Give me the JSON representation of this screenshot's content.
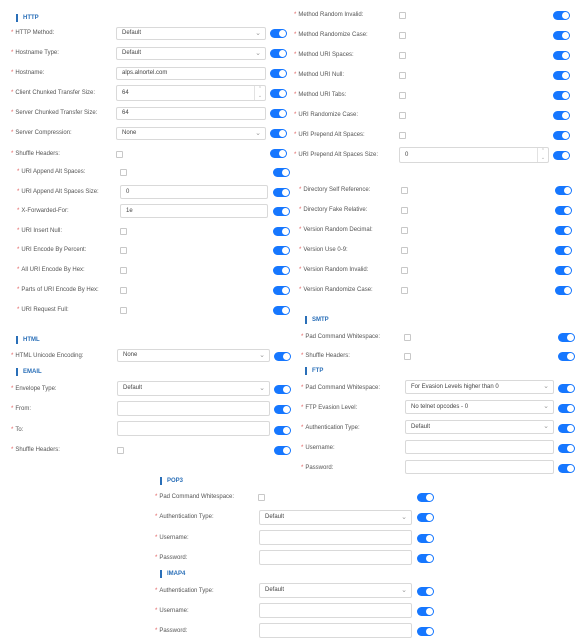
{
  "http": {
    "title": "HTTP",
    "method": {
      "label": "HTTP Method:",
      "value": "Default"
    },
    "hostname_type": {
      "label": "Hostname Type:",
      "value": "Default"
    },
    "hostname": {
      "label": "Hostname:",
      "value": "alps.alnortel.com"
    },
    "client_chunked": {
      "label": "Client Chunked Transfer Size:",
      "value": "64"
    },
    "server_chunked": {
      "label": "Server Chunked Transfer Size:",
      "value": "64"
    },
    "server_compression": {
      "label": "Server Compression:",
      "value": "None"
    },
    "shuffle_headers": {
      "label": "Shuffle Headers:"
    },
    "uri_append_alt_spaces": {
      "label": "URI Append Alt Spaces:"
    },
    "uri_append_alt_spaces_size": {
      "label": "URI Append Alt Spaces Size:",
      "value": "0"
    },
    "x_forwarded_for": {
      "label": "X-Forwarded-For:",
      "value": "1e"
    },
    "uri_insert_null": {
      "label": "URI Insert Null:"
    },
    "uri_encode_by_percent": {
      "label": "URI Encode By Percent:"
    },
    "all_uri_encode_by_hex": {
      "label": "All URI Encode By Hex:"
    },
    "parts_of_uri_encode_by_hex": {
      "label": "Parts of URI Encode By Hex:"
    },
    "uri_request_full": {
      "label": "URI Request Full:"
    },
    "method_random_invalid": {
      "label": "Method Random Invalid:"
    },
    "method_randomize_case": {
      "label": "Method Randomize Case:"
    },
    "method_uri_spaces": {
      "label": "Method URI Spaces:"
    },
    "method_uri_null": {
      "label": "Method URI Null:"
    },
    "method_uri_tabs": {
      "label": "Method URI Tabs:"
    },
    "uri_randomize_case": {
      "label": "URI Randomize Case:"
    },
    "uri_prepend_alt_spaces": {
      "label": "URI Prepend Alt Spaces:"
    },
    "uri_prepend_alt_spaces_size": {
      "label": "URI Prepend Alt Spaces Size:",
      "value": "0"
    },
    "directory_self_reference": {
      "label": "Directory Self Reference:"
    },
    "directory_fake_relative": {
      "label": "Directory Fake Relative:"
    },
    "version_random_decimal": {
      "label": "Version Random Decimal:"
    },
    "version_use_0_9": {
      "label": "Version Use 0-9:"
    },
    "version_random_invalid": {
      "label": "Version Random Invalid:"
    },
    "version_randomize_case": {
      "label": "Version Randomize Case:"
    }
  },
  "html": {
    "title": "HTML",
    "unicode_encoding": {
      "label": "HTML Unicode Encoding:",
      "value": "None"
    }
  },
  "email": {
    "title": "EMAIL",
    "envelope_type": {
      "label": "Envelope Type:",
      "value": "Default"
    },
    "from": {
      "label": "From:"
    },
    "to": {
      "label": "To:"
    },
    "shuffle_headers": {
      "label": "Shuffle Headers:"
    }
  },
  "smtp": {
    "title": "SMTP",
    "pad_command_whitespace": {
      "label": "Pad Command Whitespace:"
    },
    "shuffle_headers": {
      "label": "Shuffle Headers:"
    }
  },
  "ftp": {
    "title": "FTP",
    "pad_command_whitespace": {
      "label": "Pad Command Whitespace:",
      "value": "For Evasion Levels higher than 0"
    },
    "evasion_level": {
      "label": "FTP Evasion Level:",
      "value": "No telnet opcodes - 0"
    },
    "authentication_type": {
      "label": "Authentication Type:",
      "value": "Default"
    },
    "username": {
      "label": "Username:"
    },
    "password": {
      "label": "Password:"
    }
  },
  "pop3": {
    "title": "POP3",
    "pad_command_whitespace": {
      "label": "Pad Command Whitespace:"
    },
    "authentication_type": {
      "label": "Authentication Type:",
      "value": "Default"
    },
    "username": {
      "label": "Username:"
    },
    "password": {
      "label": "Password:"
    }
  },
  "imap4": {
    "title": "IMAP4",
    "authentication_type": {
      "label": "Authentication Type:",
      "value": "Default"
    },
    "username": {
      "label": "Username:"
    },
    "password": {
      "label": "Password:"
    }
  },
  "colors": {
    "accent": "#1677ff",
    "section": "#2a6fb8",
    "required": "#e05a5a"
  }
}
